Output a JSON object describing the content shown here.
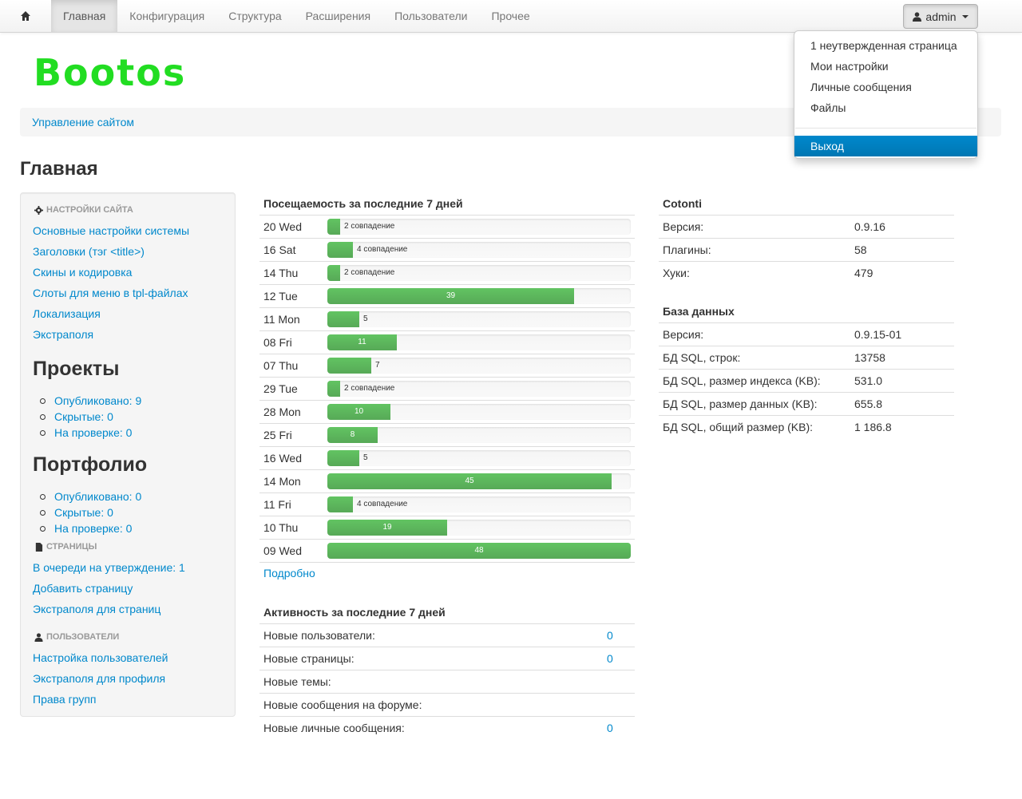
{
  "navbar": {
    "items": [
      "Главная",
      "Конфигурация",
      "Структура",
      "Расширения",
      "Пользователи",
      "Прочее"
    ],
    "user": "admin"
  },
  "dropdown": {
    "items": [
      "1 неутвержденная страница",
      "Мои настройки",
      "Личные сообщения",
      "Файлы"
    ],
    "logout": "Выход"
  },
  "logo": "Bootos",
  "breadcrumb": "Управление сайтом",
  "page_title": "Главная",
  "sidebar": {
    "settings_header": "НАСТРОЙКИ САЙТА",
    "settings_links": [
      "Основные настройки системы",
      "Заголовки (тэг <title>)",
      "Скины и кодировка",
      "Слоты для меню в tpl-файлах",
      "Локализация",
      "Экстраполя"
    ],
    "projects_title": "Проекты",
    "projects": [
      "Опубликовано: 9",
      "Скрытые: 0",
      "На проверке: 0"
    ],
    "portfolio_title": "Портфолио",
    "portfolio": [
      "Опубликовано: 0",
      "Скрытые: 0",
      "На проверке: 0"
    ],
    "pages_header": "СТРАНИЦЫ",
    "pages_links": [
      "В очереди на утверждение: 1",
      "Добавить страницу",
      "Экстраполя для страниц"
    ],
    "users_header": "ПОЛЬЗОВАТЕЛИ",
    "users_links": [
      "Настройка пользователей",
      "Экстраполя для профиля",
      "Права групп"
    ]
  },
  "traffic": {
    "title": "Посещаемость за последние 7 дней",
    "rows": [
      {
        "day": "20 Wed",
        "value": 2,
        "label": "2 совпадение"
      },
      {
        "day": "16 Sat",
        "value": 4,
        "label": "4 совпадение"
      },
      {
        "day": "14 Thu",
        "value": 2,
        "label": "2 совпадение"
      },
      {
        "day": "12 Tue",
        "value": 39,
        "label": "39"
      },
      {
        "day": "11 Mon",
        "value": 5,
        "label": "5"
      },
      {
        "day": "08 Fri",
        "value": 11,
        "label": "11"
      },
      {
        "day": "07 Thu",
        "value": 7,
        "label": "7"
      },
      {
        "day": "29 Tue",
        "value": 2,
        "label": "2 совпадение"
      },
      {
        "day": "28 Mon",
        "value": 10,
        "label": "10"
      },
      {
        "day": "25 Fri",
        "value": 8,
        "label": "8"
      },
      {
        "day": "16 Wed",
        "value": 5,
        "label": "5"
      },
      {
        "day": "14 Mon",
        "value": 45,
        "label": "45"
      },
      {
        "day": "11 Fri",
        "value": 4,
        "label": "4 совпадение"
      },
      {
        "day": "10 Thu",
        "value": 19,
        "label": "19"
      },
      {
        "day": "09 Wed",
        "value": 48,
        "label": "48"
      }
    ],
    "max": 48,
    "more": "Подробно"
  },
  "activity": {
    "title": "Активность за последние 7 дней",
    "rows": [
      {
        "label": "Новые пользователи:",
        "value": "0"
      },
      {
        "label": "Новые страницы:",
        "value": "0"
      },
      {
        "label": "Новые темы:",
        "value": ""
      },
      {
        "label": "Новые сообщения на форуме:",
        "value": ""
      },
      {
        "label": "Новые личные сообщения:",
        "value": "0"
      }
    ]
  },
  "cotonti": {
    "title": "Cotonti",
    "rows": [
      {
        "label": "Версия:",
        "value": "0.9.16"
      },
      {
        "label": "Плагины:",
        "value": "58"
      },
      {
        "label": "Хуки:",
        "value": "479"
      }
    ]
  },
  "database": {
    "title": "База данных",
    "rows": [
      {
        "label": "Версия:",
        "value": "0.9.15-01"
      },
      {
        "label": "БД SQL, строк:",
        "value": "13758"
      },
      {
        "label": "БД SQL, размер индекса (KB):",
        "value": "531.0"
      },
      {
        "label": "БД SQL, размер данных (KB):",
        "value": "655.8"
      },
      {
        "label": "БД SQL, общий размер (KB):",
        "value": "1 186.8"
      }
    ]
  }
}
